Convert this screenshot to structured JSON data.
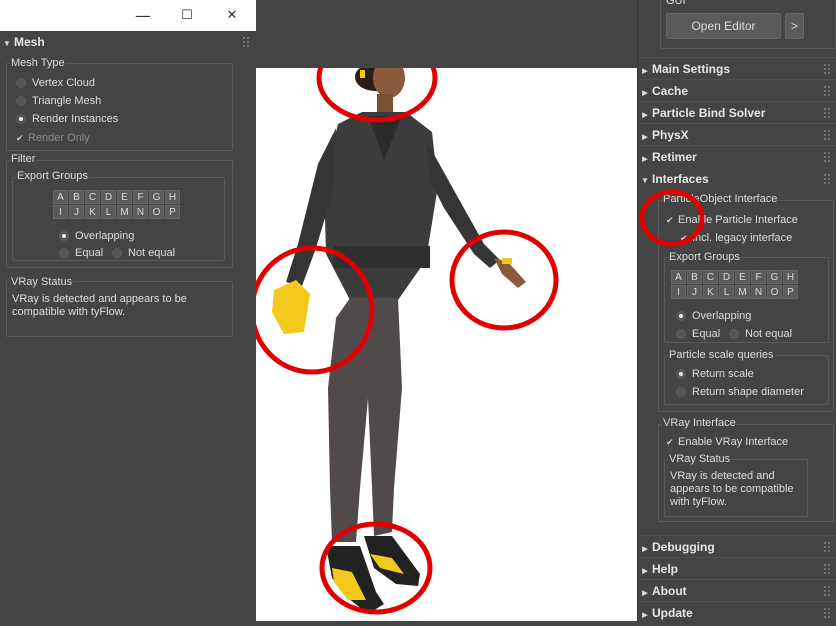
{
  "titlebar": {
    "minimize_glyph": "—",
    "maximize_glyph": "☐",
    "close_glyph": "✕"
  },
  "left_panel": {
    "rollout_title": "Mesh",
    "mesh_type": {
      "label": "Mesh Type",
      "options": [
        "Vertex Cloud",
        "Triangle Mesh",
        "Render Instances"
      ],
      "selected": "Render Instances",
      "render_only_label": "Render Only"
    },
    "filter": {
      "label": "Filter",
      "export_groups_label": "Export Groups",
      "letters": [
        "A",
        "B",
        "C",
        "D",
        "E",
        "F",
        "G",
        "H",
        "I",
        "J",
        "K",
        "L",
        "M",
        "N",
        "O",
        "P"
      ],
      "modes": [
        "Overlapping",
        "Equal",
        "Not equal"
      ],
      "selected": "Overlapping"
    },
    "vray_status": {
      "label": "VRay Status",
      "text": "VRay is detected and appears to be compatible with tyFlow."
    }
  },
  "right_panel": {
    "gui_label": "GUI",
    "open_editor_label": "Open Editor",
    "more_label": ">",
    "rollouts": [
      "Main Settings",
      "Cache",
      "Particle Bind Solver",
      "PhysX",
      "Retimer"
    ],
    "interfaces": {
      "title": "Interfaces",
      "particle_object": {
        "label": "ParticleObject Interface",
        "enable_label": "Enable Particle Interface",
        "legacy_label": "Incl. legacy interface"
      },
      "export_groups_label": "Export Groups",
      "letters": [
        "A",
        "B",
        "C",
        "D",
        "E",
        "F",
        "G",
        "H",
        "I",
        "J",
        "K",
        "L",
        "M",
        "N",
        "O",
        "P"
      ],
      "modes": [
        "Overlapping",
        "Equal",
        "Not equal"
      ],
      "scale_queries": {
        "label": "Particle scale queries",
        "options": [
          "Return scale",
          "Return shape diameter"
        ],
        "selected": "Return scale"
      },
      "vray": {
        "label": "VRay Interface",
        "enable_label": "Enable VRay Interface",
        "status_label": "VRay Status",
        "status_text": "VRay is detected and appears to be compatible with tyFlow."
      }
    },
    "bottom_rollouts": [
      "Debugging",
      "Help",
      "About",
      "Update"
    ]
  },
  "colors": {
    "annotation": "#e00000",
    "accent_yellow": "#f2c81b"
  }
}
